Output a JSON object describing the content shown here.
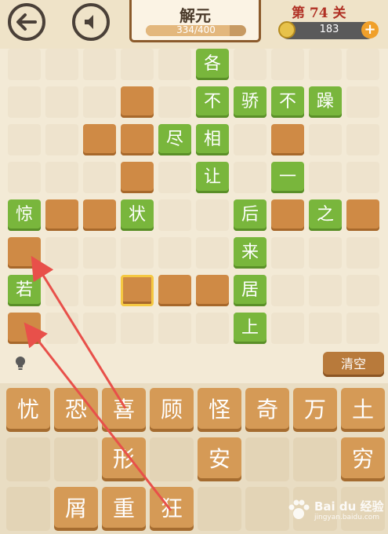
{
  "header": {
    "title": "解元",
    "progress_text": "334/400",
    "progress_fraction": 0.835,
    "level": "第 74 关",
    "coins": "183",
    "plus": "+"
  },
  "board": {
    "cols": 10,
    "rows": 8,
    "cells": [
      {
        "r": 0,
        "c": 5,
        "t": "green",
        "ch": "各"
      },
      {
        "r": 1,
        "c": 3,
        "t": "orange"
      },
      {
        "r": 1,
        "c": 5,
        "t": "green",
        "ch": "不"
      },
      {
        "r": 1,
        "c": 6,
        "t": "green",
        "ch": "骄"
      },
      {
        "r": 1,
        "c": 7,
        "t": "green",
        "ch": "不"
      },
      {
        "r": 1,
        "c": 8,
        "t": "green",
        "ch": "躁"
      },
      {
        "r": 2,
        "c": 2,
        "t": "orange"
      },
      {
        "r": 2,
        "c": 3,
        "t": "orange"
      },
      {
        "r": 2,
        "c": 4,
        "t": "green",
        "ch": "尽"
      },
      {
        "r": 2,
        "c": 5,
        "t": "green",
        "ch": "相"
      },
      {
        "r": 2,
        "c": 7,
        "t": "orange"
      },
      {
        "r": 3,
        "c": 3,
        "t": "orange"
      },
      {
        "r": 3,
        "c": 5,
        "t": "green",
        "ch": "让"
      },
      {
        "r": 3,
        "c": 7,
        "t": "green",
        "ch": "一"
      },
      {
        "r": 4,
        "c": 0,
        "t": "green",
        "ch": "惊"
      },
      {
        "r": 4,
        "c": 1,
        "t": "orange"
      },
      {
        "r": 4,
        "c": 2,
        "t": "orange"
      },
      {
        "r": 4,
        "c": 3,
        "t": "green",
        "ch": "状"
      },
      {
        "r": 4,
        "c": 6,
        "t": "green",
        "ch": "后"
      },
      {
        "r": 4,
        "c": 7,
        "t": "orange"
      },
      {
        "r": 4,
        "c": 8,
        "t": "green",
        "ch": "之"
      },
      {
        "r": 4,
        "c": 9,
        "t": "orange"
      },
      {
        "r": 5,
        "c": 0,
        "t": "orange"
      },
      {
        "r": 5,
        "c": 6,
        "t": "green",
        "ch": "来"
      },
      {
        "r": 6,
        "c": 0,
        "t": "green",
        "ch": "若"
      },
      {
        "r": 6,
        "c": 3,
        "t": "orange",
        "selected": true
      },
      {
        "r": 6,
        "c": 4,
        "t": "orange"
      },
      {
        "r": 6,
        "c": 5,
        "t": "orange"
      },
      {
        "r": 6,
        "c": 6,
        "t": "green",
        "ch": "居"
      },
      {
        "r": 7,
        "c": 0,
        "t": "orange"
      },
      {
        "r": 7,
        "c": 6,
        "t": "green",
        "ch": "上"
      }
    ]
  },
  "controls": {
    "clear_label": "清空",
    "hint_icon": "lightbulb-icon"
  },
  "tray": {
    "cols": 8,
    "rows": 3,
    "tiles": [
      {
        "r": 0,
        "c": 0,
        "ch": "忧"
      },
      {
        "r": 0,
        "c": 1,
        "ch": "恐"
      },
      {
        "r": 0,
        "c": 2,
        "ch": "喜"
      },
      {
        "r": 0,
        "c": 3,
        "ch": "顾"
      },
      {
        "r": 0,
        "c": 4,
        "ch": "怪"
      },
      {
        "r": 0,
        "c": 5,
        "ch": "奇"
      },
      {
        "r": 0,
        "c": 6,
        "ch": "万"
      },
      {
        "r": 0,
        "c": 7,
        "ch": "土"
      },
      {
        "r": 1,
        "c": 2,
        "ch": "形"
      },
      {
        "r": 1,
        "c": 4,
        "ch": "安"
      },
      {
        "r": 1,
        "c": 7,
        "ch": "穷"
      },
      {
        "r": 2,
        "c": 1,
        "ch": "屑"
      },
      {
        "r": 2,
        "c": 2,
        "ch": "重"
      },
      {
        "r": 2,
        "c": 3,
        "ch": "狂"
      }
    ]
  },
  "watermark": {
    "title": "Bai du 经验",
    "sub": "jingyan.baidu.com"
  },
  "colors": {
    "green": "#79b63c",
    "orange": "#cf8a45",
    "arrow": "#e8504a",
    "accent": "#b03024"
  }
}
